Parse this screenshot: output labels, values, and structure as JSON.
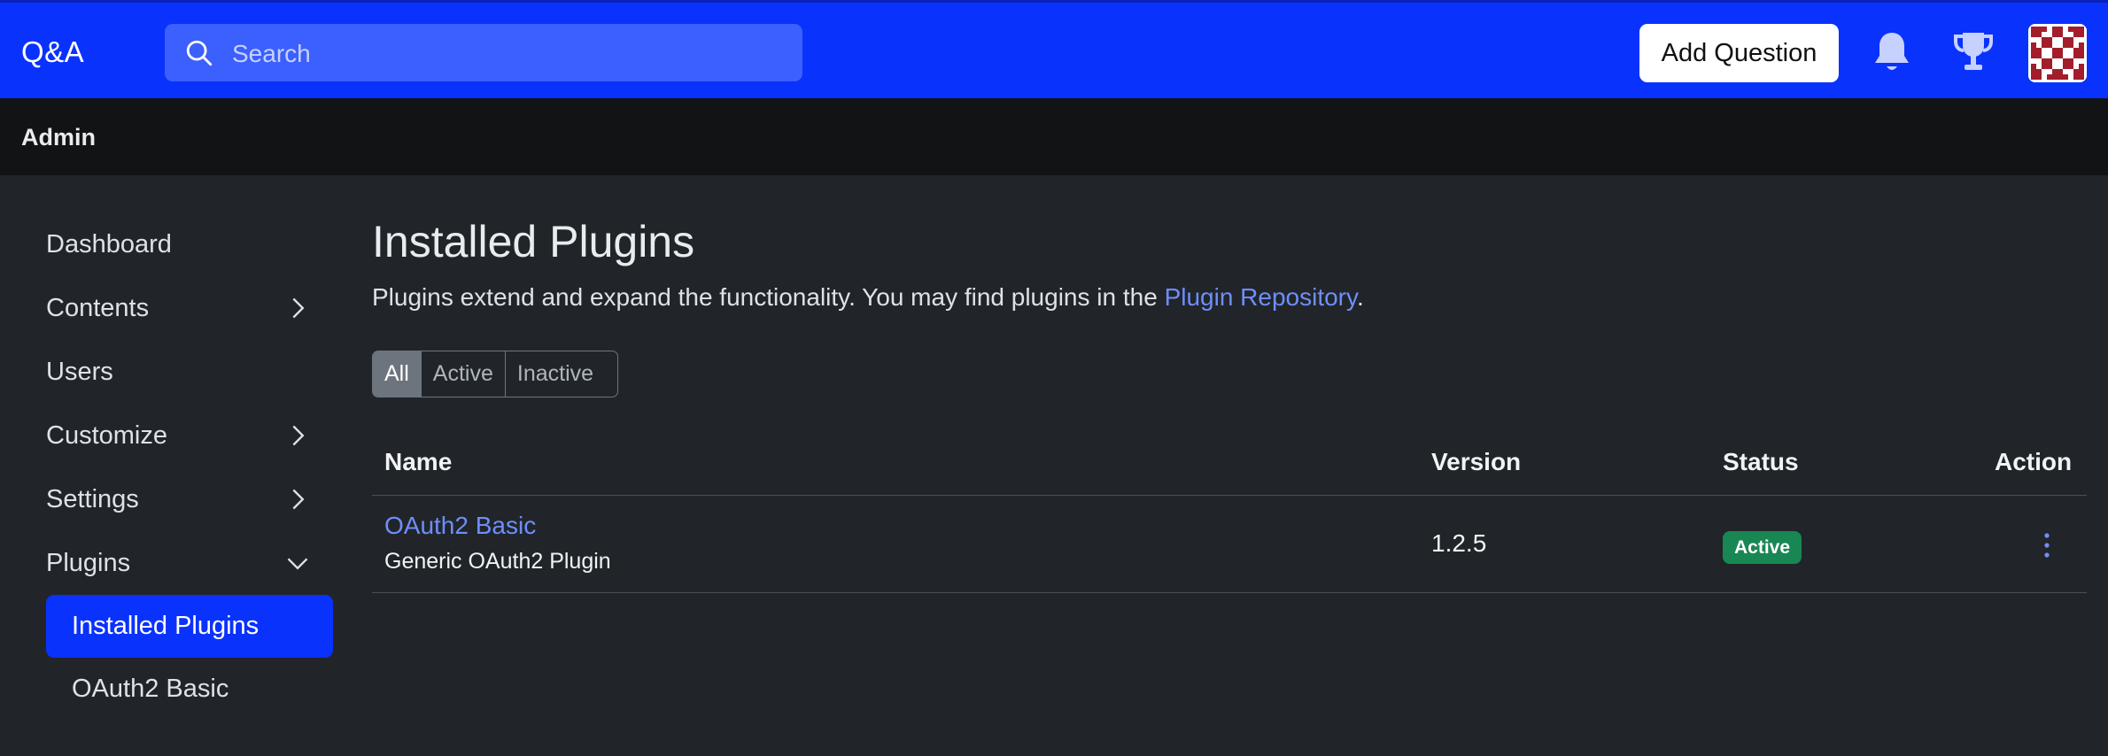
{
  "navbar": {
    "brand": "Q&A",
    "search_placeholder": "Search",
    "add_question_label": "Add Question",
    "icons": [
      "search-icon",
      "bell-icon",
      "trophy-icon",
      "avatar"
    ],
    "accent_color": "#0a32fd"
  },
  "admin_bar": {
    "title": "Admin"
  },
  "sidebar": {
    "items": [
      {
        "label": "Dashboard"
      },
      {
        "label": "Contents"
      },
      {
        "label": "Users"
      },
      {
        "label": "Customize"
      },
      {
        "label": "Settings"
      },
      {
        "label": "Plugins"
      }
    ],
    "plugins_submenu": [
      {
        "label": "Installed Plugins",
        "active": true
      },
      {
        "label": "OAuth2 Basic",
        "active": false
      }
    ]
  },
  "main": {
    "title": "Installed Plugins",
    "description_prefix": "Plugins extend and expand the functionality. You may find plugins in the ",
    "description_link": "Plugin Repository",
    "description_suffix": ".",
    "filters": [
      {
        "label": "All",
        "active": true
      },
      {
        "label": "Active",
        "active": false
      },
      {
        "label": "Inactive",
        "active": false
      }
    ],
    "table": {
      "columns": [
        "Name",
        "Version",
        "Status",
        "Action"
      ],
      "rows": [
        {
          "name": "OAuth2 Basic",
          "description": "Generic OAuth2 Plugin",
          "version": "1.2.5",
          "status": "Active",
          "status_color": "#198754"
        }
      ]
    }
  }
}
